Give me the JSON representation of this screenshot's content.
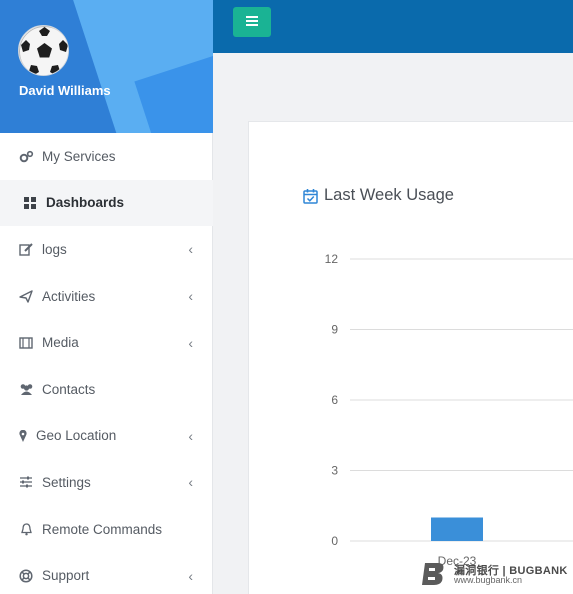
{
  "user": {
    "name": "David Williams"
  },
  "sidebar": {
    "items": [
      {
        "label": "My Services",
        "icon": "cogs-icon",
        "has_submenu": false
      },
      {
        "label": "Dashboards",
        "icon": "grid-icon",
        "has_submenu": false,
        "active": true
      },
      {
        "label": "logs",
        "icon": "edit-icon",
        "has_submenu": true
      },
      {
        "label": "Activities",
        "icon": "paper-plane-icon",
        "has_submenu": true
      },
      {
        "label": "Media",
        "icon": "film-icon",
        "has_submenu": true
      },
      {
        "label": "Contacts",
        "icon": "users-icon",
        "has_submenu": false
      },
      {
        "label": "Geo Location",
        "icon": "map-marker-icon",
        "has_submenu": true
      },
      {
        "label": "Settings",
        "icon": "sliders-icon",
        "has_submenu": true
      },
      {
        "label": "Remote Commands",
        "icon": "bell-icon",
        "has_submenu": false
      },
      {
        "label": "Support",
        "icon": "life-ring-icon",
        "has_submenu": true
      }
    ],
    "chevron": "‹"
  },
  "topbar": {
    "toggle_icon": "hamburger-icon"
  },
  "card": {
    "title": "Last Week Usage",
    "icon": "calendar-check-icon"
  },
  "chart_data": {
    "type": "bar",
    "title": "Last Week Usage",
    "categories": [
      "Dec-23"
    ],
    "values": [
      1
    ],
    "yticks": [
      "0",
      "3",
      "6",
      "9",
      "12"
    ],
    "ylim": [
      0,
      12
    ],
    "grid": true,
    "bar_color": "#3a8fd9"
  },
  "watermark": {
    "brand": "漏洞银行 | BUGBANK",
    "url": "www.bugbank.cn"
  },
  "colors": {
    "topbar": "#0a6aac",
    "toggle": "#1ab394",
    "profile": "#3b8fe3"
  }
}
